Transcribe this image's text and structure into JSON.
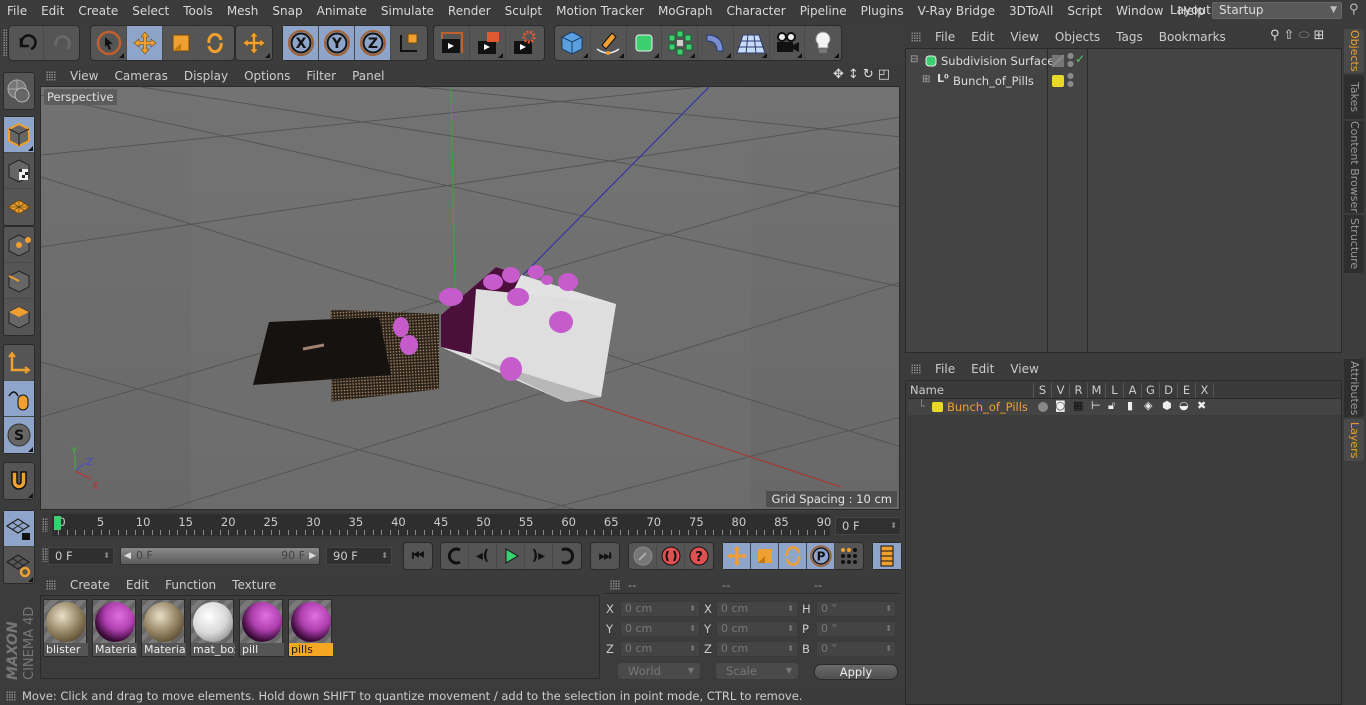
{
  "menubar": {
    "items": [
      "File",
      "Edit",
      "Create",
      "Select",
      "Tools",
      "Mesh",
      "Snap",
      "Animate",
      "Simulate",
      "Render",
      "Sculpt",
      "Motion Tracker",
      "MoGraph",
      "Character",
      "Pipeline",
      "Plugins",
      "V-Ray Bridge",
      "3DToAll",
      "Script",
      "Window",
      "Help"
    ],
    "layout_label": "Layout:",
    "layout_value": "Startup"
  },
  "toolbar": {
    "undo": "undo-icon",
    "redo": "redo-icon",
    "tools": [
      "live-selection",
      "move",
      "scale",
      "rotate",
      "recent-tool"
    ],
    "axis": [
      "X",
      "Y",
      "Z"
    ],
    "coordinate_system": "world-coordinates-icon",
    "render": [
      "render-view",
      "render-picture-viewer",
      "edit-render-settings"
    ],
    "objects": [
      "cube",
      "pen",
      "subdivision-surface",
      "cloner",
      "bend-deformer",
      "floor",
      "camera",
      "light"
    ]
  },
  "left_toolbar": [
    "make-editable",
    "model",
    "texture",
    "workplane",
    "points",
    "edges",
    "polygons",
    "axis",
    "tweak",
    "solo",
    "snap",
    "locked-workplane",
    "planar-workplane"
  ],
  "viewport": {
    "menu": [
      "View",
      "Cameras",
      "Display",
      "Options",
      "Filter",
      "Panel"
    ],
    "camera_label": "Perspective",
    "grid_spacing": "Grid Spacing : 10 cm",
    "axis_labels": [
      "Y",
      "Z",
      "X"
    ]
  },
  "timeline": {
    "ticks": [
      0,
      5,
      10,
      15,
      20,
      25,
      30,
      35,
      40,
      45,
      50,
      55,
      60,
      65,
      70,
      75,
      80,
      85,
      90
    ],
    "current_frame": 0,
    "max_frame": 90,
    "frame_display": "0 F"
  },
  "transport": {
    "start_field": "0 F",
    "range_start": "0 F",
    "range_end": "90 F",
    "end_field": "90 F"
  },
  "materials": {
    "menu": [
      "Create",
      "Edit",
      "Function",
      "Texture"
    ],
    "items": [
      {
        "name": "blister",
        "type": "metal"
      },
      {
        "name": "Material",
        "type": "pink"
      },
      {
        "name": "Material",
        "type": "metal"
      },
      {
        "name": "mat_box",
        "type": "white"
      },
      {
        "name": "pill",
        "type": "pink"
      },
      {
        "name": "pills",
        "type": "pink",
        "selected": true
      }
    ]
  },
  "coordinates": {
    "headers": [
      "--",
      "--",
      "--"
    ],
    "rows": [
      {
        "l1": "X",
        "v1": "0 cm",
        "l2": "X",
        "v2": "0 cm",
        "l3": "H",
        "v3": "0 °"
      },
      {
        "l1": "Y",
        "v1": "0 cm",
        "l2": "Y",
        "v2": "0 cm",
        "l3": "P",
        "v3": "0 °"
      },
      {
        "l1": "Z",
        "v1": "0 cm",
        "l2": "Z",
        "v2": "0 cm",
        "l3": "B",
        "v3": "0 °"
      }
    ],
    "mode": "World",
    "size_mode": "Scale",
    "apply": "Apply"
  },
  "status": "Move: Click and drag to move elements. Hold down SHIFT to quantize movement / add to the selection in point mode, CTRL to remove.",
  "object_manager": {
    "menu": [
      "File",
      "Edit",
      "View",
      "Objects",
      "Tags",
      "Bookmarks"
    ],
    "objects": [
      {
        "name": "Subdivision Surface",
        "icon": "subdivision-surface-icon",
        "color": null
      },
      {
        "name": "Bunch_of_Pills",
        "icon": "null-object-icon",
        "color": "#e8d82a"
      }
    ]
  },
  "layer_manager": {
    "menu": [
      "File",
      "Edit",
      "View"
    ],
    "columns": [
      "Name",
      "S",
      "V",
      "R",
      "M",
      "L",
      "A",
      "G",
      "D",
      "E",
      "X"
    ],
    "layers": [
      {
        "name": "Bunch_of_Pills",
        "color": "#e8d82a"
      }
    ]
  },
  "right_tabs": {
    "top": [
      {
        "label": "Objects",
        "active": true
      },
      {
        "label": "Takes"
      },
      {
        "label": "Content Browser"
      },
      {
        "label": "Structure"
      }
    ],
    "bottom": [
      {
        "label": "Attributes"
      },
      {
        "label": "Layers",
        "active": true
      }
    ]
  },
  "colors": {
    "accent": "#f0a030",
    "selection_blue": "#8ea4c8",
    "layer_yellow": "#e8d82a"
  },
  "branding": {
    "line1": "MAXON",
    "line2": "CINEMA 4D"
  }
}
